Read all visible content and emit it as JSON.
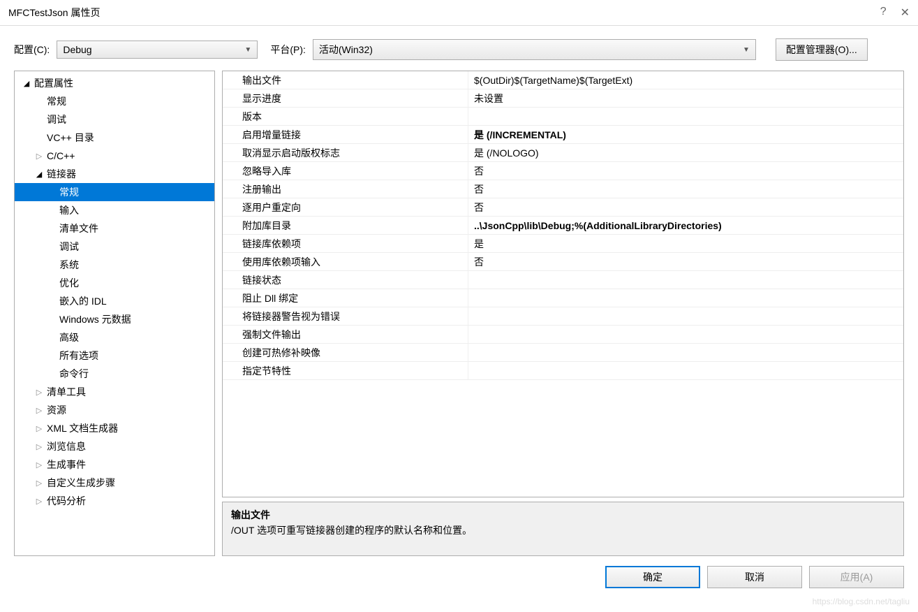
{
  "window": {
    "title": "MFCTestJson 属性页",
    "help": "?",
    "close": "✕"
  },
  "toolbar": {
    "config_label": "配置(C):",
    "config_value": "Debug",
    "platform_label": "平台(P):",
    "platform_value": "活动(Win32)",
    "config_mgr": "配置管理器(O)..."
  },
  "tree": [
    {
      "label": "配置属性",
      "level": 0,
      "expanded": true,
      "hasChildren": true
    },
    {
      "label": "常规",
      "level": 1,
      "expanded": false,
      "hasChildren": false
    },
    {
      "label": "调试",
      "level": 1,
      "expanded": false,
      "hasChildren": false
    },
    {
      "label": "VC++ 目录",
      "level": 1,
      "expanded": false,
      "hasChildren": false
    },
    {
      "label": "C/C++",
      "level": 1,
      "expanded": false,
      "hasChildren": true
    },
    {
      "label": "链接器",
      "level": 1,
      "expanded": true,
      "hasChildren": true
    },
    {
      "label": "常规",
      "level": 2,
      "expanded": false,
      "hasChildren": false,
      "selected": true
    },
    {
      "label": "输入",
      "level": 2,
      "expanded": false,
      "hasChildren": false
    },
    {
      "label": "清单文件",
      "level": 2,
      "expanded": false,
      "hasChildren": false
    },
    {
      "label": "调试",
      "level": 2,
      "expanded": false,
      "hasChildren": false
    },
    {
      "label": "系统",
      "level": 2,
      "expanded": false,
      "hasChildren": false
    },
    {
      "label": "优化",
      "level": 2,
      "expanded": false,
      "hasChildren": false
    },
    {
      "label": "嵌入的 IDL",
      "level": 2,
      "expanded": false,
      "hasChildren": false
    },
    {
      "label": "Windows 元数据",
      "level": 2,
      "expanded": false,
      "hasChildren": false
    },
    {
      "label": "高级",
      "level": 2,
      "expanded": false,
      "hasChildren": false
    },
    {
      "label": "所有选项",
      "level": 2,
      "expanded": false,
      "hasChildren": false
    },
    {
      "label": "命令行",
      "level": 2,
      "expanded": false,
      "hasChildren": false
    },
    {
      "label": "清单工具",
      "level": 1,
      "expanded": false,
      "hasChildren": true
    },
    {
      "label": "资源",
      "level": 1,
      "expanded": false,
      "hasChildren": true
    },
    {
      "label": "XML 文档生成器",
      "level": 1,
      "expanded": false,
      "hasChildren": true
    },
    {
      "label": "浏览信息",
      "level": 1,
      "expanded": false,
      "hasChildren": true
    },
    {
      "label": "生成事件",
      "level": 1,
      "expanded": false,
      "hasChildren": true
    },
    {
      "label": "自定义生成步骤",
      "level": 1,
      "expanded": false,
      "hasChildren": true
    },
    {
      "label": "代码分析",
      "level": 1,
      "expanded": false,
      "hasChildren": true
    }
  ],
  "props": [
    {
      "label": "输出文件",
      "value": "$(OutDir)$(TargetName)$(TargetExt)",
      "bold": false
    },
    {
      "label": "显示进度",
      "value": "未设置",
      "bold": false
    },
    {
      "label": "版本",
      "value": "",
      "bold": false
    },
    {
      "label": "启用增量链接",
      "value": "是 (/INCREMENTAL)",
      "bold": true
    },
    {
      "label": "取消显示启动版权标志",
      "value": "是 (/NOLOGO)",
      "bold": false
    },
    {
      "label": "忽略导入库",
      "value": "否",
      "bold": false
    },
    {
      "label": "注册输出",
      "value": "否",
      "bold": false
    },
    {
      "label": "逐用户重定向",
      "value": "否",
      "bold": false
    },
    {
      "label": "附加库目录",
      "value": "..\\JsonCpp\\lib\\Debug;%(AdditionalLibraryDirectories)",
      "bold": true
    },
    {
      "label": "链接库依赖项",
      "value": "是",
      "bold": false
    },
    {
      "label": "使用库依赖项输入",
      "value": "否",
      "bold": false
    },
    {
      "label": "链接状态",
      "value": "",
      "bold": false
    },
    {
      "label": "阻止 Dll 绑定",
      "value": "",
      "bold": false
    },
    {
      "label": "将链接器警告视为错误",
      "value": "",
      "bold": false
    },
    {
      "label": "强制文件输出",
      "value": "",
      "bold": false
    },
    {
      "label": "创建可热修补映像",
      "value": "",
      "bold": false
    },
    {
      "label": "指定节特性",
      "value": "",
      "bold": false
    }
  ],
  "desc": {
    "title": "输出文件",
    "text": "/OUT 选项可重写链接器创建的程序的默认名称和位置。"
  },
  "buttons": {
    "ok": "确定",
    "cancel": "取消",
    "apply": "应用(A)"
  },
  "watermark": "https://blog.csdn.net/tagliu"
}
